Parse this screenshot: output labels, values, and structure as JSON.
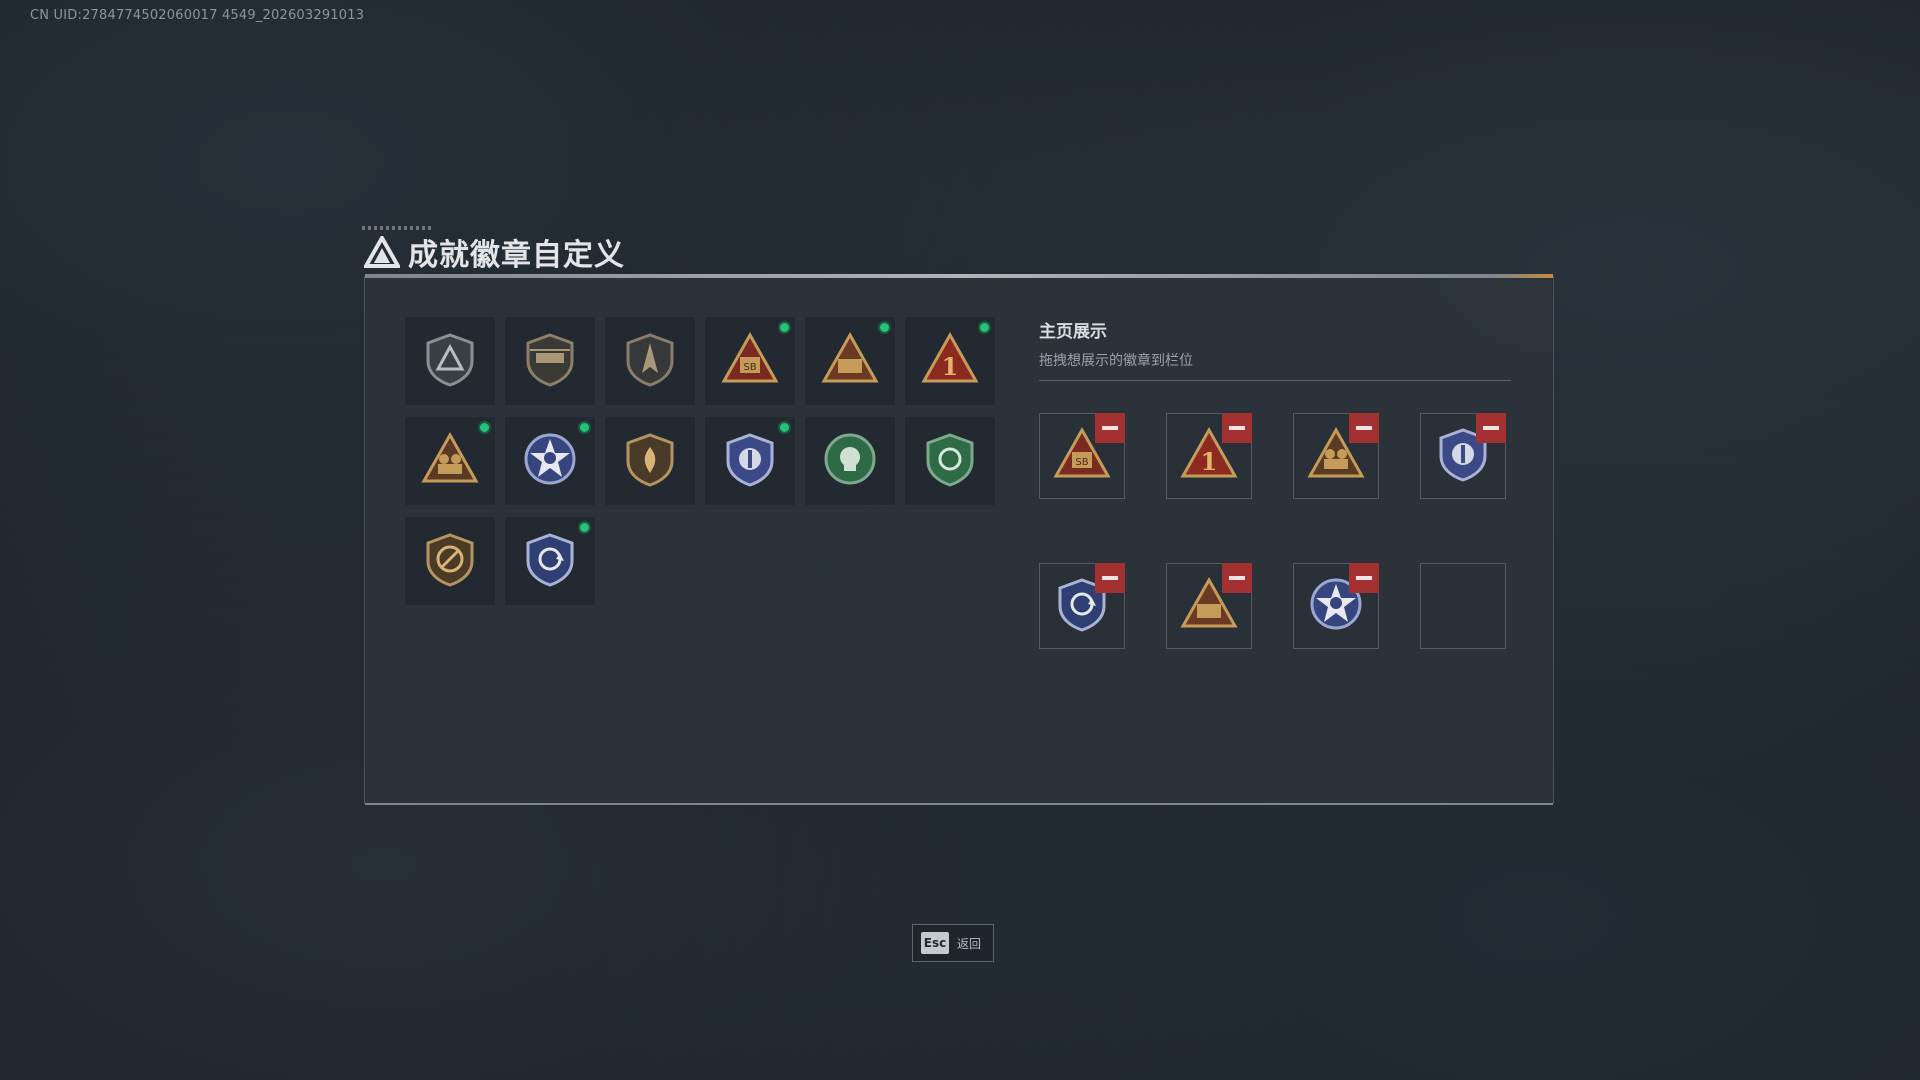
{
  "uid_text": "CN UID:2784774502060017 4549_202603291013",
  "title": "成就徽章自定义",
  "showcase": {
    "title": "主页展示",
    "subtitle": "拖拽想展示的徽章到栏位"
  },
  "badges": [
    {
      "icon": "shield-triangle-icon",
      "new": false
    },
    {
      "icon": "helicopter-shield-icon",
      "new": false
    },
    {
      "icon": "jet-shield-icon",
      "new": false
    },
    {
      "icon": "triangle-sb-icon",
      "new": true,
      "text": "SB"
    },
    {
      "icon": "triangle-missile-icon",
      "new": true
    },
    {
      "icon": "triangle-one-icon",
      "new": true,
      "text": "1"
    },
    {
      "icon": "triangle-soldiers-icon",
      "new": true
    },
    {
      "icon": "star-skull-emblem-icon",
      "new": true
    },
    {
      "icon": "shield-flame-icon",
      "new": false
    },
    {
      "icon": "police-badge-icon",
      "new": true
    },
    {
      "icon": "green-skull-emblem-icon",
      "new": false
    },
    {
      "icon": "green-shield-refresh-icon",
      "new": false
    },
    {
      "icon": "no-gun-shield-icon",
      "new": false
    },
    {
      "icon": "blue-shield-refresh-icon",
      "new": true
    }
  ],
  "slots": [
    {
      "icon": "triangle-sb-icon",
      "filled": true,
      "text": "SB"
    },
    {
      "icon": "triangle-one-icon",
      "filled": true,
      "text": "1"
    },
    {
      "icon": "triangle-soldiers-icon",
      "filled": true
    },
    {
      "icon": "police-badge-icon",
      "filled": true
    },
    {
      "icon": "blue-shield-refresh-icon",
      "filled": true
    },
    {
      "icon": "triangle-missile-icon",
      "filled": true
    },
    {
      "icon": "star-skull-emblem-icon",
      "filled": true
    },
    {
      "icon": "empty-slot",
      "filled": false
    }
  ],
  "footer": {
    "esc_key": "Esc",
    "esc_label": "返回"
  },
  "colors": {
    "gold": "#c59b5a",
    "red_triangle": "#8c2a20",
    "navy": "#3b4a86",
    "green": "#2f6a46",
    "new_dot": "#27c17a",
    "remove": "#a33131"
  }
}
